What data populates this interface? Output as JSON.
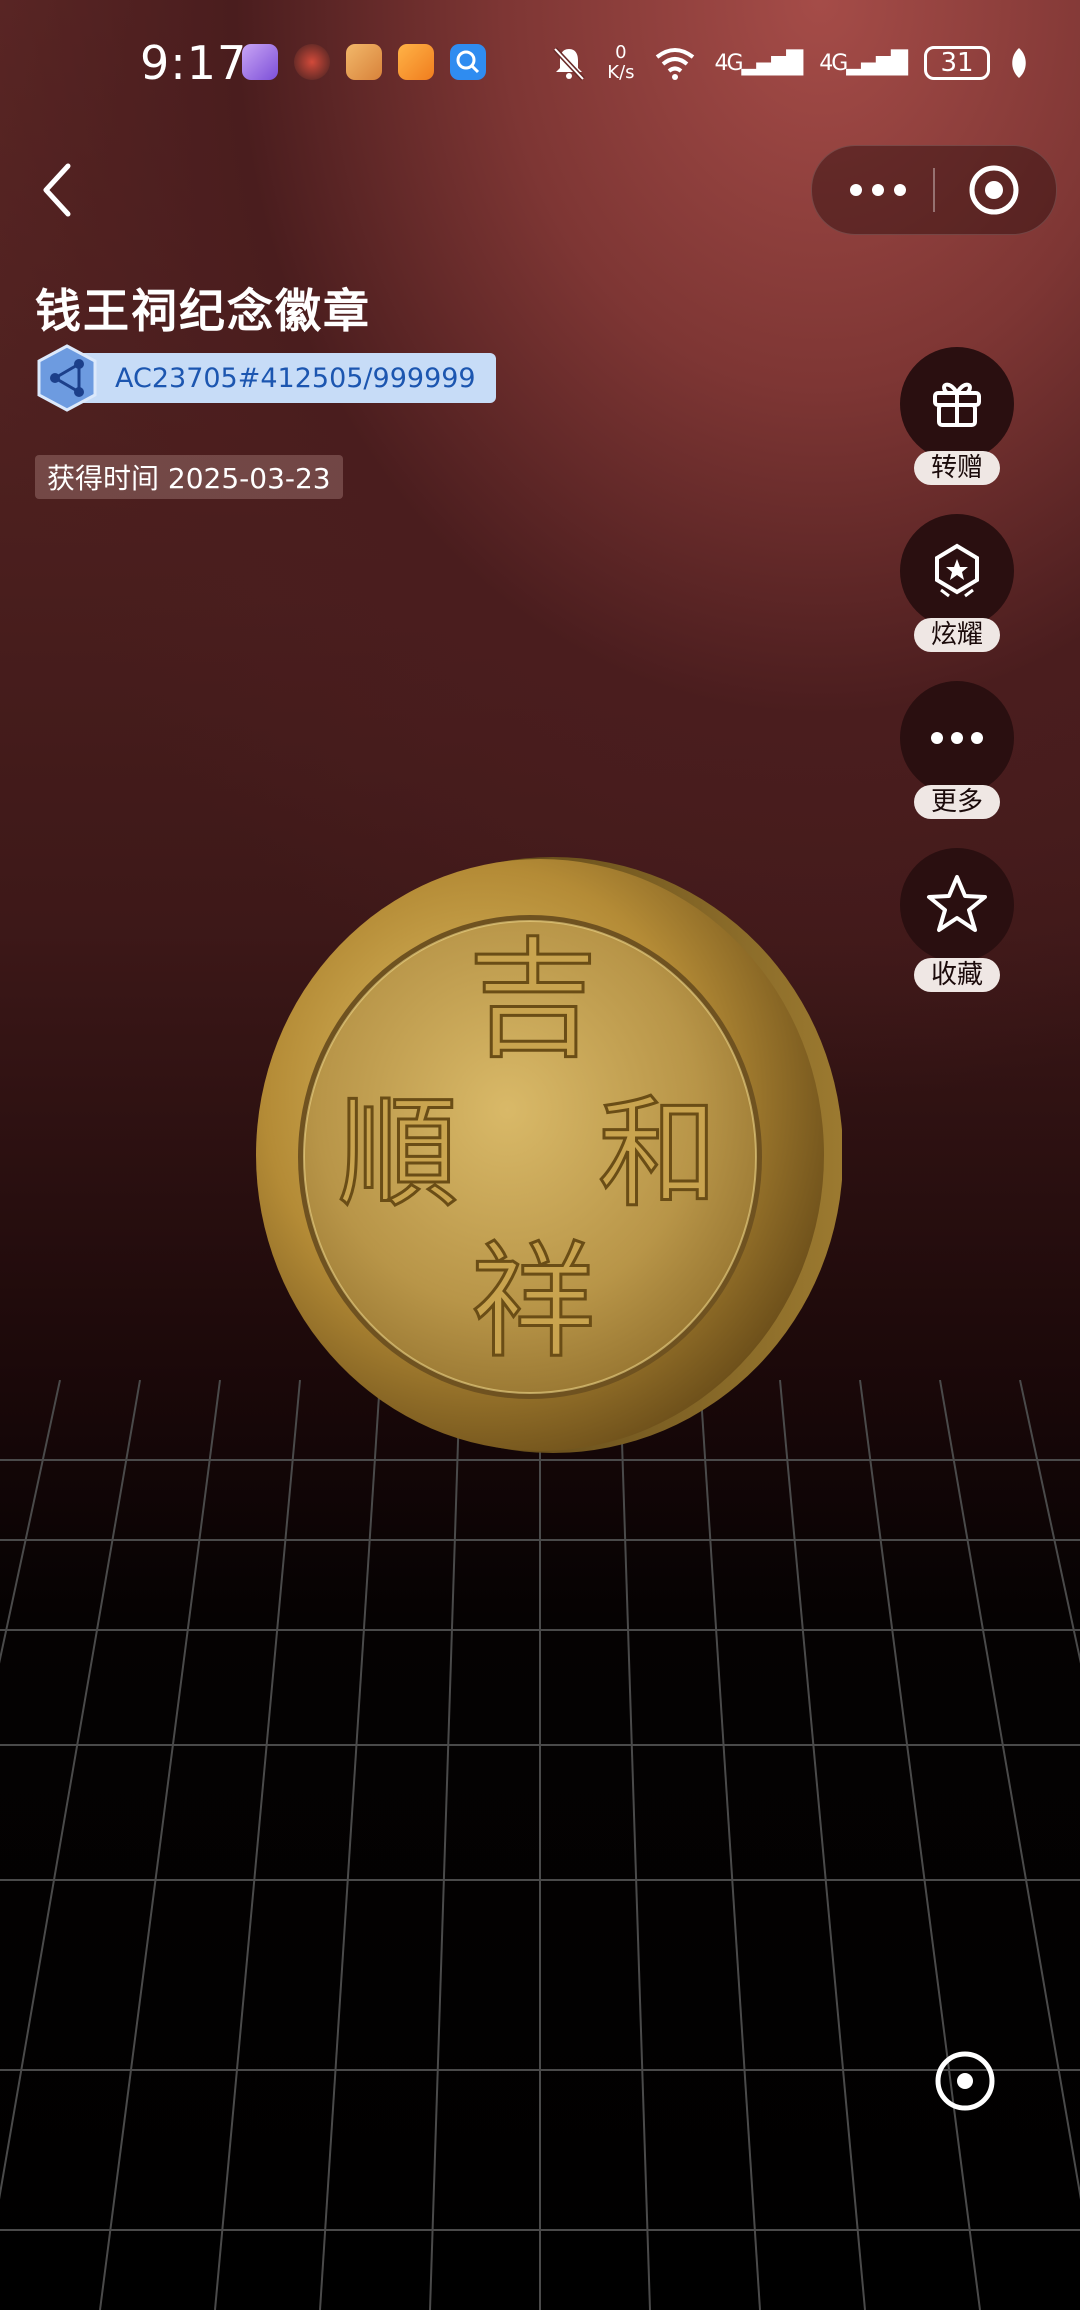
{
  "status_bar": {
    "time": "9:17",
    "net_speed_value": "0",
    "net_speed_unit": "K/s",
    "signal1": "4G",
    "signal2": "4G",
    "battery": "31",
    "app_icons": [
      "app-icon-purple",
      "app-icon-avatar",
      "app-icon-game",
      "app-icon-orange",
      "app-icon-search"
    ]
  },
  "nav": {
    "back_icon": "chevron-left-icon",
    "more_icon": "more-dots-icon",
    "close_icon": "target-circle-icon"
  },
  "badge": {
    "title": "钱王祠纪念徽章",
    "chain_id": "AC23705#412505/999999",
    "acquired": "获得时间 2025-03-23"
  },
  "actions": [
    {
      "label": "转赠",
      "icon": "gift-icon"
    },
    {
      "label": "炫耀",
      "icon": "star-badge-icon"
    },
    {
      "label": "更多",
      "icon": "more-dots-icon"
    },
    {
      "label": "收藏",
      "icon": "star-outline-icon"
    }
  ],
  "coin": {
    "top": "吉",
    "right": "和",
    "bottom": "祥",
    "left": "順"
  },
  "colors": {
    "chain_pill": "#c7dcf7",
    "chain_text": "#1c56b0",
    "gold": "#c9a44f"
  }
}
